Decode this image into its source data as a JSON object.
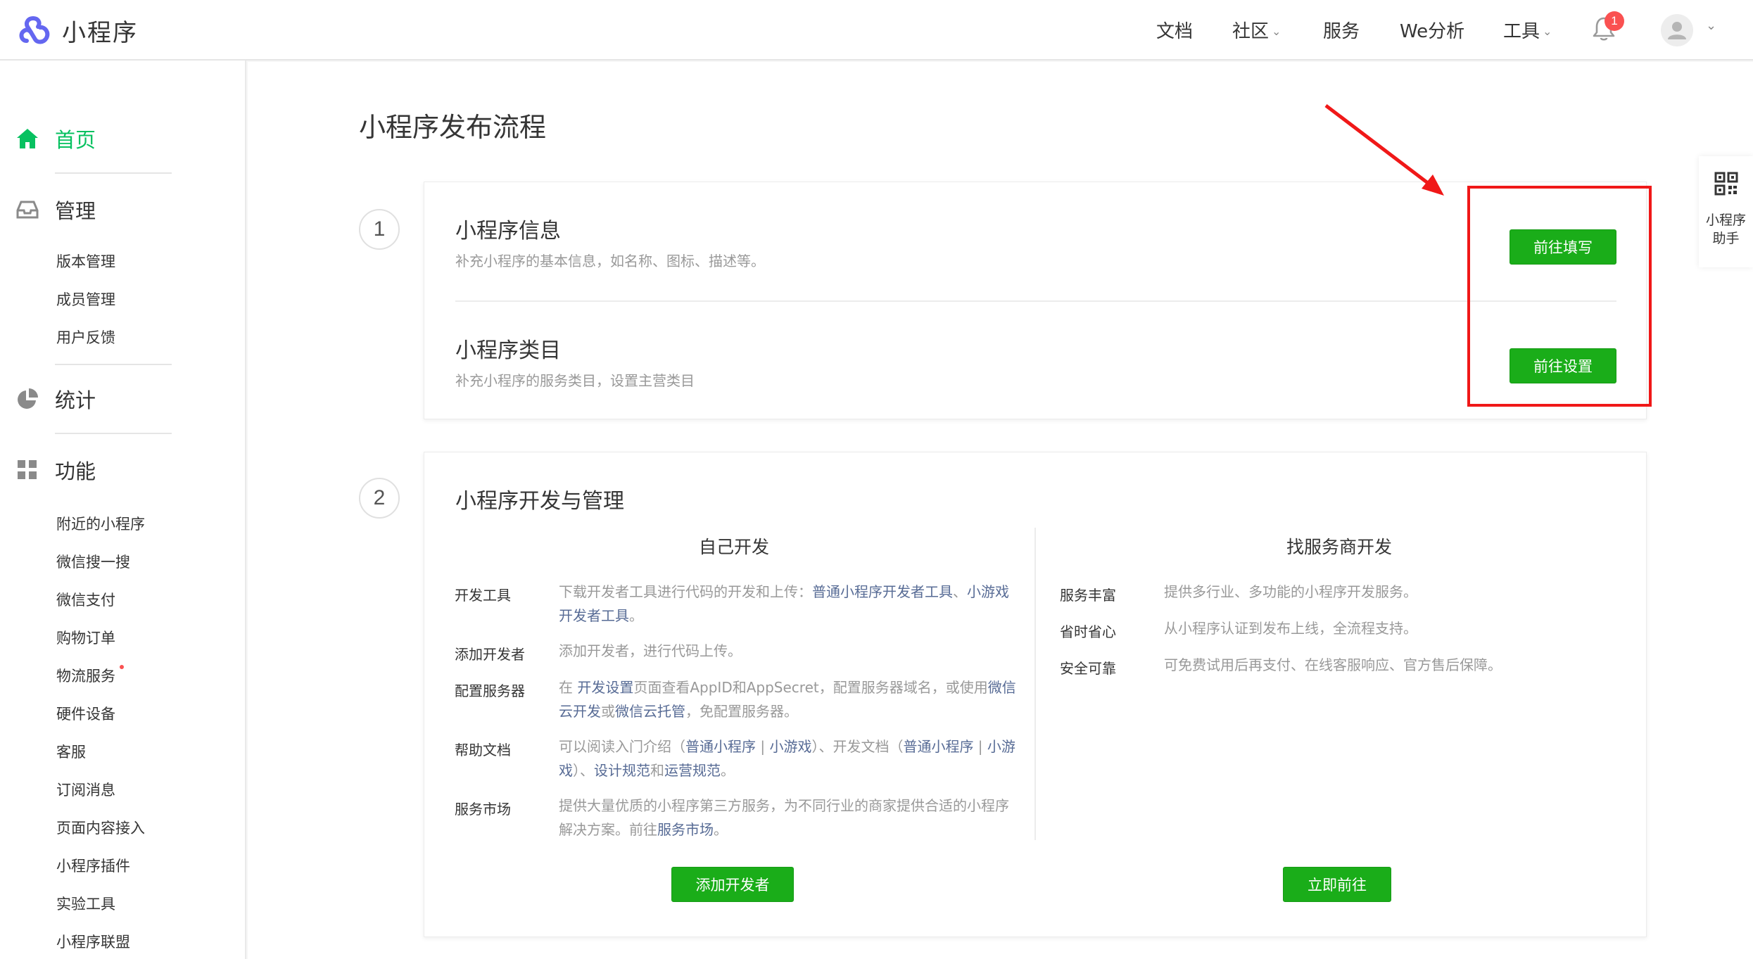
{
  "app": {
    "name": "小程序",
    "accent": "#07c160",
    "button_green": "#1aad19",
    "link_color": "#576b95"
  },
  "topnav": {
    "items": [
      {
        "label": "文档",
        "dropdown": false
      },
      {
        "label": "社区",
        "dropdown": true
      },
      {
        "label": "服务",
        "dropdown": false
      },
      {
        "label": "We分析",
        "dropdown": false
      },
      {
        "label": "工具",
        "dropdown": true
      }
    ],
    "notification_count": "1",
    "icons": [
      "bell-icon",
      "avatar-icon",
      "chevron-down-icon"
    ]
  },
  "sidebar": {
    "home": "首页",
    "manage": {
      "title": "管理",
      "items": [
        "版本管理",
        "成员管理",
        "用户反馈"
      ]
    },
    "stats": "统计",
    "features": {
      "title": "功能",
      "items": [
        "附近的小程序",
        "微信搜一搜",
        "微信支付",
        "购物订单",
        "物流服务",
        "硬件设备",
        "客服",
        "订阅消息",
        "页面内容接入",
        "小程序插件",
        "实验工具",
        "小程序联盟"
      ]
    }
  },
  "main": {
    "title": "小程序发布流程",
    "step1": {
      "number": "1",
      "info_title": "小程序信息",
      "info_desc": "补充小程序的基本信息，如名称、图标、描述等。",
      "info_button": "前往填写",
      "category_title": "小程序类目",
      "category_desc": "补充小程序的服务类目，设置主营类目",
      "category_button": "前往设置"
    },
    "step2": {
      "number": "2",
      "title": "小程序开发与管理",
      "self_dev": {
        "heading": "自己开发",
        "rows": [
          {
            "label": "开发工具",
            "t1": "下载开发者工具进行代码的开发和上传：",
            "l1": "普通小程序开发者工具",
            "t2": "、",
            "l2": "小游戏开发者工具",
            "t3": "。"
          },
          {
            "label": "添加开发者",
            "t1": "添加开发者，进行代码上传。"
          },
          {
            "label": "配置服务器",
            "t1": "在 ",
            "l1": "开发设置",
            "t2": "页面查看AppID和AppSecret，配置服务器域名，或使用",
            "l2": "微信云开发",
            "t3": "或",
            "l3": "微信云托管",
            "t4": "，免配置服务器。"
          },
          {
            "label": "帮助文档",
            "t1": "可以阅读入门介绍（",
            "l1": "普通小程序",
            "t2": " | ",
            "l2": "小游戏",
            "t3": "）、开发文档（",
            "l3": "普通小程序",
            "t4": " | ",
            "l4": "小游戏",
            "t5": "）、",
            "l5": "设计规范",
            "t6": "和",
            "l6": "运营规范",
            "t7": "。"
          },
          {
            "label": "服务市场",
            "t1": "提供大量优质的小程序第三方服务，为不同行业的商家提供合适的小程序解决方案。前往",
            "l1": "服务市场",
            "t2": "。"
          }
        ],
        "button": "添加开发者"
      },
      "vendor_dev": {
        "heading": "找服务商开发",
        "rows": [
          {
            "label": "服务丰富",
            "text": "提供多行业、多功能的小程序开发服务。"
          },
          {
            "label": "省时省心",
            "text": "从小程序认证到发布上线，全流程支持。"
          },
          {
            "label": "安全可靠",
            "text": "可免费试用后再支付、在线客服响应、官方售后保障。"
          }
        ],
        "button": "立即前往"
      }
    }
  },
  "helper": {
    "label_line1": "小程序",
    "label_line2": "助手",
    "icon": "qr-code-icon"
  },
  "annotation": {
    "highlight_color": "#f01818"
  }
}
